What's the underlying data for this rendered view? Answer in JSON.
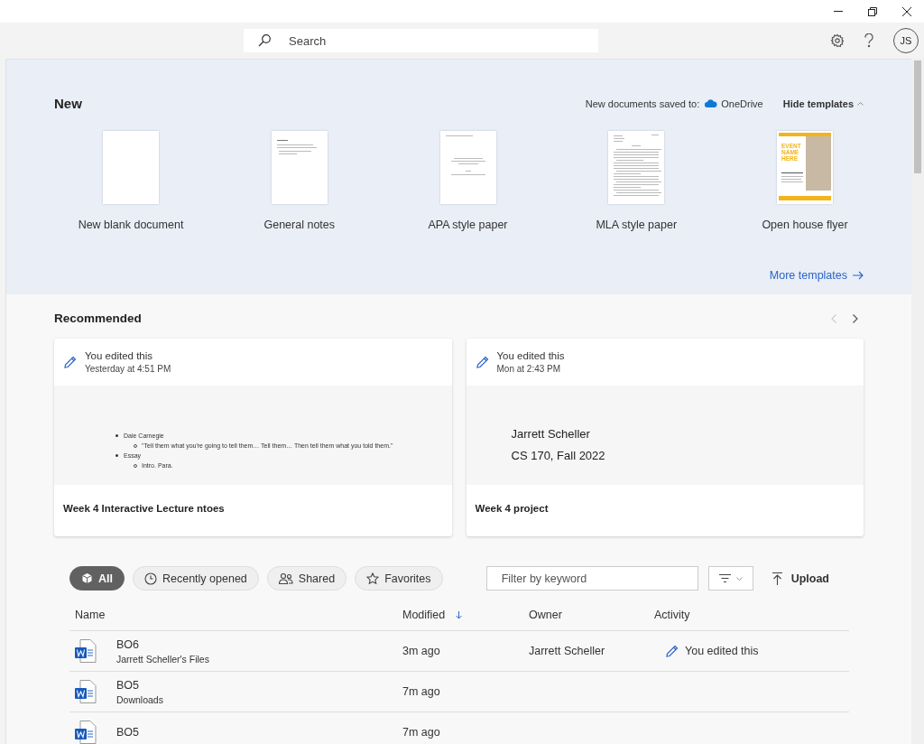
{
  "search": {
    "placeholder": "Search"
  },
  "account": {
    "initials": "JS"
  },
  "new_section": {
    "title": "New",
    "save_location_label": "New documents saved to:",
    "save_location": "OneDrive",
    "hide_templates": "Hide templates",
    "more_templates": "More templates",
    "templates": [
      {
        "name": "New blank document",
        "kind": "blank"
      },
      {
        "name": "General notes",
        "kind": "notes"
      },
      {
        "name": "APA style paper",
        "kind": "apa"
      },
      {
        "name": "MLA style paper",
        "kind": "mla"
      },
      {
        "name": "Open house flyer",
        "kind": "flyer",
        "heading": "EVENT NAME HERE"
      }
    ]
  },
  "recommended": {
    "title": "Recommended",
    "cards": [
      {
        "activity": "You edited this",
        "time": "Yesterday at 4:51 PM",
        "kind": "outline",
        "name": "Week 4 Interactive Lecture ntoes",
        "preview": [
          {
            "text": "Dale Carnegie",
            "children": [
              {
                "text": "\"Tell them what you're going to tell them… Tell them… Then tell them what you told them.\""
              }
            ]
          },
          {
            "text": "Essay",
            "children": [
              {
                "text": "Intro. Para."
              }
            ]
          }
        ]
      },
      {
        "activity": "You edited this",
        "time": "Mon at 2:43 PM",
        "kind": "lines",
        "name": "Week 4 project",
        "preview": [
          {
            "text": "Jarrett Scheller"
          },
          {
            "text": "CS 170, Fall 2022"
          }
        ]
      }
    ]
  },
  "files": {
    "filters": [
      {
        "label": "All",
        "kind": "all",
        "selected": true
      },
      {
        "label": "Recently opened",
        "kind": "recent",
        "selected": false
      },
      {
        "label": "Shared",
        "kind": "shared",
        "selected": false
      },
      {
        "label": "Favorites",
        "kind": "favorites",
        "selected": false
      }
    ],
    "filter_placeholder": "Filter by keyword",
    "upload": "Upload",
    "columns": [
      "Name",
      "Modified",
      "Owner",
      "Activity"
    ],
    "rows": [
      {
        "name": "BO6",
        "location": "Jarrett Scheller's Files",
        "modified": "3m ago",
        "owner": "Jarrett Scheller",
        "activity": "You edited this"
      },
      {
        "name": "BO5",
        "location": "Downloads",
        "modified": "7m ago"
      },
      {
        "name": "BO5",
        "modified": "7m ago"
      }
    ]
  }
}
